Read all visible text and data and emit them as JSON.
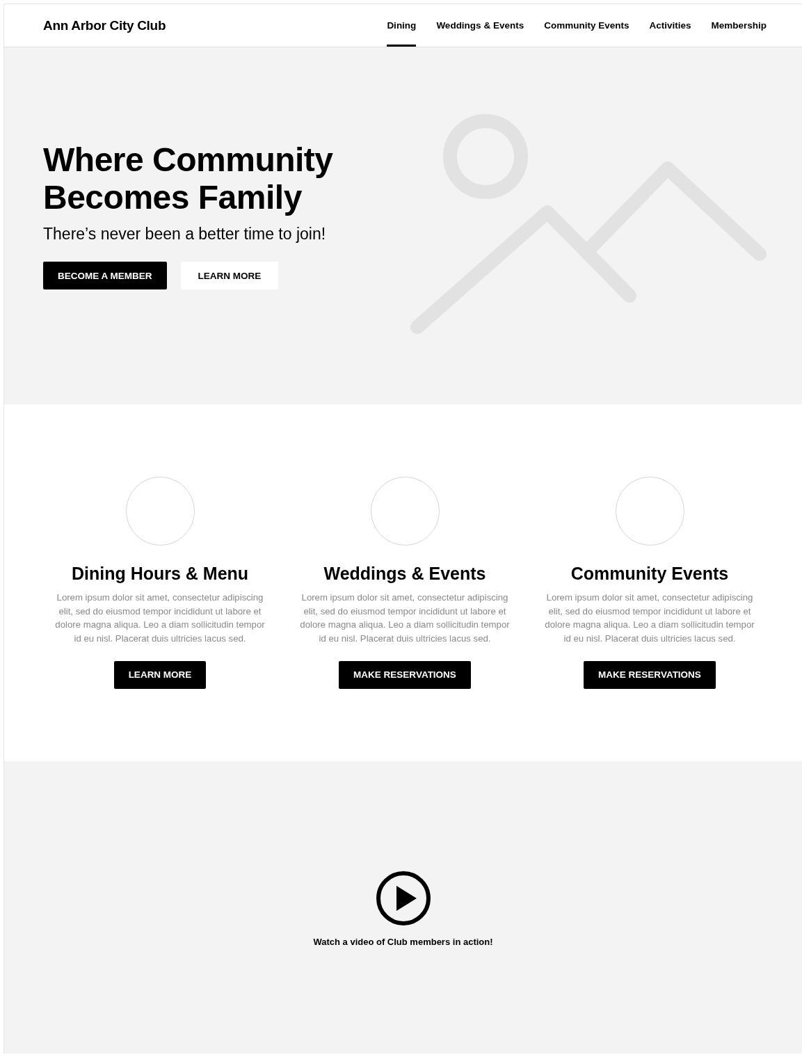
{
  "header": {
    "logo": "Ann Arbor City Club",
    "nav": [
      {
        "label": "Dining",
        "selected": true
      },
      {
        "label": "Weddings & Events",
        "selected": false
      },
      {
        "label": "Community Events",
        "selected": false
      },
      {
        "label": "Activities",
        "selected": false
      },
      {
        "label": "Membership",
        "selected": false
      }
    ]
  },
  "hero": {
    "title": "Where Community Becomes Family",
    "subtitle": "There’s never been a better time to join!",
    "buttons": [
      {
        "label": "BECOME A MEMBER",
        "kind": "primary"
      },
      {
        "label": "LEARN MORE",
        "kind": "secondary"
      }
    ]
  },
  "features": [
    {
      "title": "Dining Hours & Menu",
      "text": "Lorem ipsum dolor sit amet, consectetur adipiscing elit, sed do eiusmod tempor incididunt ut labore et dolore magna aliqua. Leo a diam sollicitudin tempor id eu nisl. Placerat duis ultricies lacus sed.",
      "button": "LEARN MORE"
    },
    {
      "title": "Weddings & Events",
      "text": "Lorem ipsum dolor sit amet, consectetur adipiscing elit, sed do eiusmod tempor incididunt ut labore et dolore magna aliqua. Leo a diam sollicitudin tempor id eu nisl. Placerat duis ultricies lacus sed.",
      "button": "MAKE RESERVATIONS"
    },
    {
      "title": "Community Events",
      "text": "Lorem ipsum dolor sit amet, consectetur adipiscing elit, sed do eiusmod tempor incididunt ut labore et dolore magna aliqua. Leo a diam sollicitudin tempor id eu nisl. Placerat duis ultricies lacus sed.",
      "button": "MAKE RESERVATIONS"
    }
  ],
  "video": {
    "caption": "Watch a video of Club members in action!"
  }
}
